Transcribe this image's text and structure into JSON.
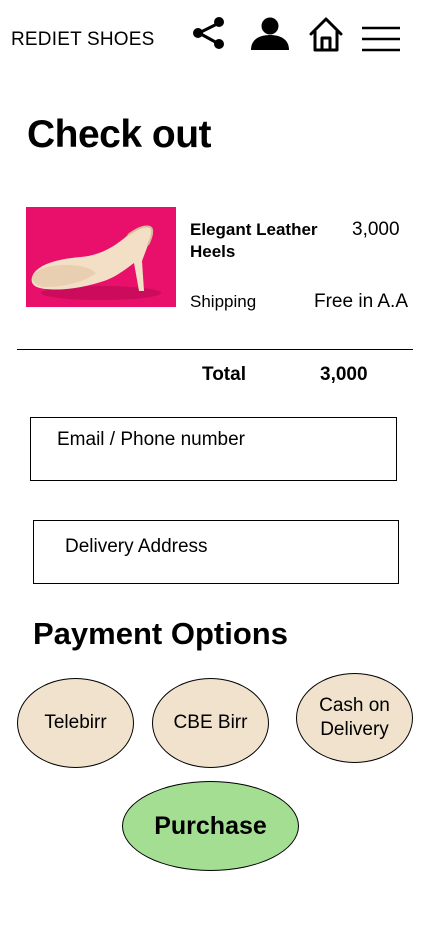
{
  "header": {
    "brand": "REDIET SHOES",
    "icons": [
      "share-icon",
      "user-icon",
      "home-icon",
      "menu-icon"
    ]
  },
  "page_title": "Check out",
  "cart": {
    "item_name": "Elegant Leather Heels",
    "item_price": "3,000",
    "shipping_label": "Shipping",
    "shipping_value": "Free in A.A",
    "total_label": "Total",
    "total_value": "3,000"
  },
  "form": {
    "email_placeholder": "Email / Phone number",
    "address_placeholder": "Delivery Address"
  },
  "payment": {
    "heading": "Payment Options",
    "options": [
      "Telebirr",
      "CBE Birr",
      "Cash on Delivery"
    ]
  },
  "purchase_label": "Purchase",
  "colors": {
    "option_fill": "#f0e2cc",
    "purchase_fill": "#a3de92",
    "product_background": "#e8106b"
  }
}
